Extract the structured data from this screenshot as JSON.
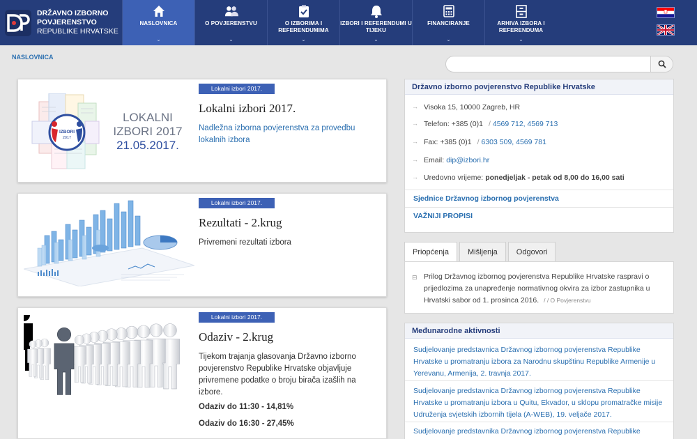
{
  "header": {
    "logo": {
      "line1": "DRŽAVNO IZBORNO",
      "line2": "POVJERENSTVO",
      "line3": "REPUBLIKE HRVATSKE"
    },
    "nav": [
      {
        "label": "NASLOVNICA",
        "icon": "home-icon",
        "active": true
      },
      {
        "label": "O POVJERENSTVU",
        "icon": "people-icon",
        "active": false
      },
      {
        "label": "O IZBORIMA I REFERENDUMIMA",
        "icon": "clipboard-icon",
        "active": false
      },
      {
        "label": "IZBORI I REFERENDUMI U TIJEKU",
        "icon": "bell-icon",
        "active": false
      },
      {
        "label": "FINANCIRANJE",
        "icon": "calculator-icon",
        "active": false
      },
      {
        "label": "ARHIVA IZBORA I REFERENDUMA",
        "icon": "archive-icon",
        "active": false
      }
    ],
    "flags": [
      "croatian-flag-icon",
      "uk-flag-icon"
    ]
  },
  "breadcrumb": "NASLOVNICA",
  "search": {
    "placeholder": ""
  },
  "cards": [
    {
      "badge": "Lokalni izbori 2017.",
      "title": "Lokalni izbori 2017.",
      "desc": "Nadležna izborna povjerenstva za provedbu lokalnih izbora",
      "image": {
        "line1": "LOKALNI",
        "line2": "IZBORI 2017",
        "line3": "21.05.2017.",
        "emblem_line1": "IZBORI",
        "emblem_line2": "2017"
      }
    },
    {
      "badge": "Lokalni izbori 2017.",
      "title": "Rezultati - 2.krug",
      "desc": "Privremeni rezultati izbora"
    },
    {
      "badge": "Lokalni izbori 2017.",
      "title": "Odaziv - 2.krug",
      "desc": "Tijekom trajanja glasovanja Državno izborno povjerenstvo Republike Hrvatske objavljuje privremene podatke o broju birača izašlih na izbore.",
      "stats": [
        "Odaziv do 11:30 - 14,81%",
        "Odaziv do 16:30 - 27,45%"
      ]
    }
  ],
  "contact": {
    "title": "Državno izborno povjerenstvo Republike Hrvatske",
    "address": "Visoka 15, 10000 Zagreb, HR",
    "phone_label": "Telefon: +385 (0)1",
    "phone_numbers": "4569 712, 4569 713",
    "fax_label": "Fax: +385 (0)1",
    "fax_numbers": "6303 509, 4569 781",
    "email_label": "Email:",
    "email": "dip@izbori.hr",
    "hours_label": "Uredovno vrijeme:",
    "hours": "ponedjeljak - petak od 8,00 do 16,00 sati",
    "link1": "Sjednice Državnog izbornog povjerenstva",
    "link2": "VAŽNIJI PROPISI",
    "separator": "/"
  },
  "tabs": [
    {
      "label": "Priopćenja",
      "active": true
    },
    {
      "label": "Mišljenja",
      "active": false
    },
    {
      "label": "Odgovori",
      "active": false
    }
  ],
  "tab_item": {
    "text": "Prilog Državnog izbornog povjerenstva Republike Hrvatske raspravi o prijedlozima za unapređenje normativnog okvira za izbor zastupnika u Hrvatski sabor od 1. prosinca 2016.",
    "meta": "/ / O Povjerenstvu"
  },
  "international": {
    "title": "Međunarodne aktivnosti",
    "items": [
      "Sudjelovanje predstavnica Državnog izbornog povjerenstva Republike Hrvatske u promatranju izbora za Narodnu skupštinu Republike Armenije u Yerevanu, Armenija, 2. travnja 2017.",
      "Sudjelovanje predstavnica Državnog izbornog povjerenstva Republike Hrvatske u promatranju izbora u Quitu, Ekvador, u sklopu promatračke misije Udruženja svjetskih izbornih tijela (A-WEB), 19. veljače 2017.",
      "Sudjelovanje predstavnika Državnog izbornog povjerenstva Republike Hrvatske"
    ]
  },
  "colors": {
    "header": "#253d7b",
    "active_nav": "#3d61b5",
    "link": "#2a6fb0",
    "badge": "#3d61b5"
  }
}
